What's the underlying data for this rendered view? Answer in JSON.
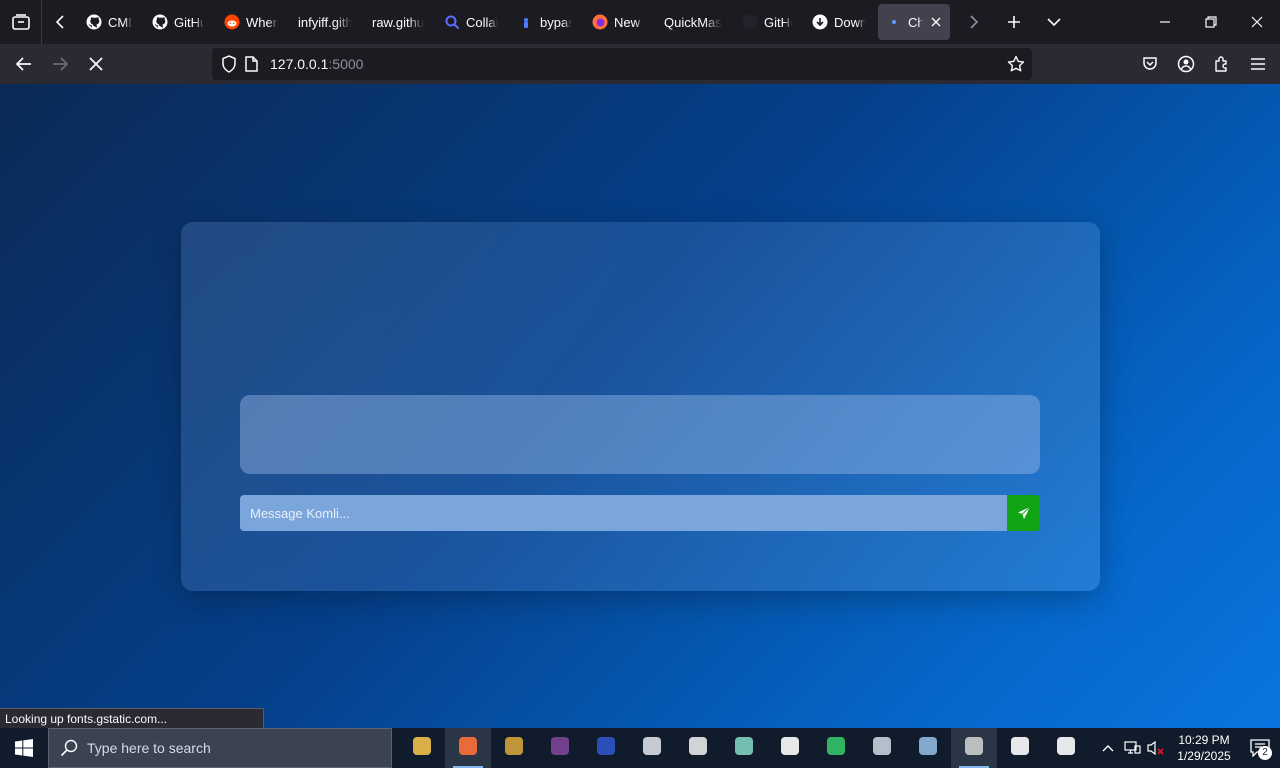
{
  "browser": {
    "tabs": [
      {
        "label": "CMD",
        "icon": "github-icon"
      },
      {
        "label": "GitHu",
        "icon": "github-icon"
      },
      {
        "label": "When",
        "icon": "reddit-icon"
      },
      {
        "label": "infyiff.gith",
        "icon": ""
      },
      {
        "label": "raw.githul",
        "icon": ""
      },
      {
        "label": "Collab",
        "icon": "search-icon"
      },
      {
        "label": "bypas",
        "icon": "page-icon"
      },
      {
        "label": "New T",
        "icon": "firefox-icon"
      },
      {
        "label": "QuickMas",
        "icon": ""
      },
      {
        "label": "GitHu",
        "icon": "github-dark-icon"
      },
      {
        "label": "Down",
        "icon": "download-icon"
      },
      {
        "label": "Ch",
        "icon": "loading-icon",
        "active": true
      }
    ],
    "url": {
      "host": "127.0.0.1",
      "port": ":5000"
    }
  },
  "chat": {
    "input_placeholder": "Message Komli..."
  },
  "status_text": "Looking up fonts.gstatic.com...",
  "taskbar": {
    "search_placeholder": "Type here to search",
    "apps": [
      {
        "name": "file-explorer-icon",
        "color": "#f0c04a"
      },
      {
        "name": "firefox-icon",
        "color": "#ff7139",
        "active": true
      },
      {
        "name": "game-icon",
        "color": "#d4a23a"
      },
      {
        "name": "tor-icon",
        "color": "#7d4698"
      },
      {
        "name": "vs-icon",
        "color": "#2f55c9"
      },
      {
        "name": "roblox-icon",
        "color": "#d8dde4"
      },
      {
        "name": "star-icon",
        "color": "#e8e8e8"
      },
      {
        "name": "box-icon",
        "color": "#7fd0c0"
      },
      {
        "name": "7zip-icon",
        "color": "#ffffff"
      },
      {
        "name": "edge-icon",
        "color": "#35c46a"
      },
      {
        "name": "drive-icon",
        "color": "#c8d2dc"
      },
      {
        "name": "network-icon",
        "color": "#8fb8e0"
      },
      {
        "name": "terminal-icon",
        "color": "#cccccc",
        "active": true
      },
      {
        "name": "app-icon",
        "color": "#ffffff"
      },
      {
        "name": "app2-icon",
        "color": "#ffffff"
      }
    ],
    "time": "10:29 PM",
    "date": "1/29/2025",
    "notification_count": "2"
  }
}
